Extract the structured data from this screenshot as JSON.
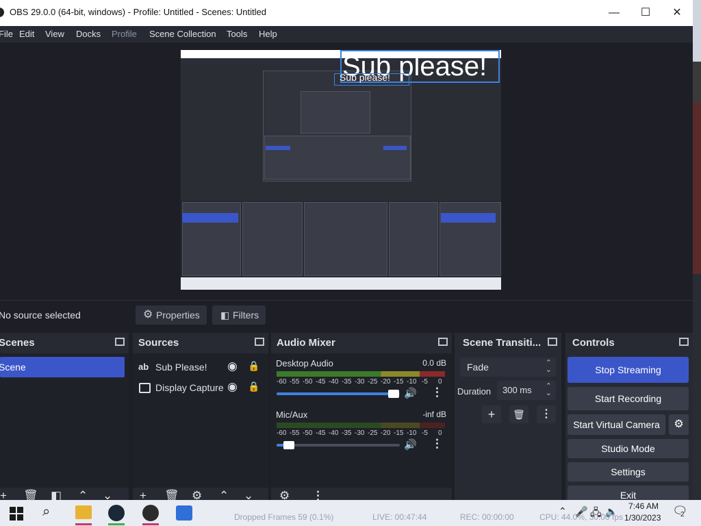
{
  "window": {
    "title": "OBS 29.0.0 (64-bit, windows) - Profile: Untitled - Scenes: Untitled",
    "minimize": "—",
    "maximize": "☐",
    "close": "✕"
  },
  "menu": {
    "items": [
      "File",
      "Edit",
      "View",
      "Docks",
      "Profile",
      "Scene Collection",
      "Tools",
      "Help"
    ]
  },
  "preview": {
    "overlay_text": "Sub please!",
    "overlay_small": "Sub please!"
  },
  "toolbar": {
    "status": "No source selected",
    "properties": "Properties",
    "filters": "Filters"
  },
  "docks": {
    "scenes": {
      "title": "Scenes",
      "items": [
        "Scene"
      ]
    },
    "sources": {
      "title": "Sources",
      "items": [
        {
          "icon": "text-icon",
          "label": "Sub Please!"
        },
        {
          "icon": "display-icon",
          "label": "Display Capture"
        }
      ]
    },
    "audio": {
      "title": "Audio Mixer",
      "channels": [
        {
          "name": "Desktop Audio",
          "level": "0.0 dB",
          "volume": 0.95
        },
        {
          "name": "Mic/Aux",
          "level": "-inf dB",
          "volume": 0.1
        }
      ],
      "ticks": [
        "-60",
        "-55",
        "-50",
        "-45",
        "-40",
        "-35",
        "-30",
        "-25",
        "-20",
        "-15",
        "-10",
        "-5",
        "0"
      ]
    },
    "transitions": {
      "title": "Scene Transiti...",
      "selected": "Fade",
      "duration_label": "Duration",
      "duration_value": "300 ms"
    },
    "controls": {
      "title": "Controls",
      "stop_streaming": "Stop Streaming",
      "start_recording": "Start Recording",
      "start_virtual_camera": "Start Virtual Camera",
      "studio_mode": "Studio Mode",
      "settings": "Settings",
      "exit": "Exit"
    }
  },
  "statusbar": {
    "dropped": "Dropped Frames 59 (0.1%)",
    "live": "LIVE: 00:47:44",
    "rec": "REC: 00:00:00",
    "cpu": "CPU: 44.0%, 30.00 fps"
  },
  "taskbar": {
    "time": "7:46 AM",
    "date": "1/30/2023",
    "notifications": "2"
  },
  "colors": {
    "accent": "#3b56c8",
    "panel": "#272a33",
    "background": "#1e1f26"
  }
}
